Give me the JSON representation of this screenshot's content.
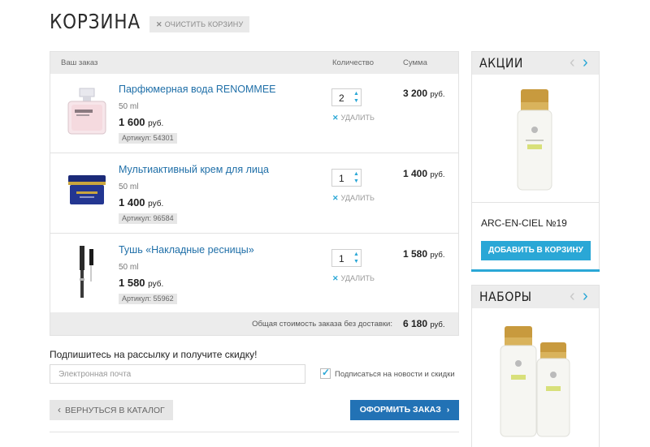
{
  "page": {
    "title": "КОРЗИНА",
    "clear_button": "ОЧИСТИТЬ КОРЗИНУ"
  },
  "cart": {
    "headers": {
      "order": "Ваш заказ",
      "quantity": "Количество",
      "sum": "Сумма"
    },
    "items": [
      {
        "name": "Парфюмерная вода RENOMMEE",
        "volume": "50 ml",
        "price": "1 600",
        "currency": "руб.",
        "sku": "Артикул: 54301",
        "qty": "2",
        "remove": "УДАЛИТЬ",
        "sum": "3 200",
        "image": "perfume-bottle"
      },
      {
        "name": "Мультиактивный крем для лица",
        "volume": "50 ml",
        "price": "1 400",
        "currency": "руб.",
        "sku": "Артикул: 96584",
        "qty": "1",
        "remove": "УДАЛИТЬ",
        "sum": "1 400",
        "image": "cream-jar"
      },
      {
        "name": "Тушь «Накладные ресницы»",
        "volume": "50 ml",
        "price": "1 580",
        "currency": "руб.",
        "sku": "Артикул: 55962",
        "qty": "1",
        "remove": "УДАЛИТЬ",
        "sum": "1 580",
        "image": "mascara"
      }
    ],
    "total_label": "Общая стоимость заказа без доставки:",
    "total": "6 180",
    "currency": "руб."
  },
  "subscribe": {
    "title": "Подпишитесь на рассылку и получите скидку!",
    "email_placeholder": "Электронная почта",
    "checkbox_label": "Подписаться на новости и скидки",
    "checked": true
  },
  "actions": {
    "back": "ВЕРНУТЬСЯ В КАТАЛОГ",
    "checkout": "ОФОРМИТЬ ЗАКАЗ"
  },
  "sidebar": {
    "promo": {
      "title": "АКЦИИ",
      "product": "ARC-EN-CIEL №19",
      "button": "ДОБАВИТЬ В КОРЗИНУ"
    },
    "sets": {
      "title": "НАБОРЫ"
    }
  },
  "colors": {
    "accent": "#2aa7d6",
    "primary_button": "#2272b5",
    "link": "#1f6fa8",
    "header_bg": "#ececec"
  }
}
